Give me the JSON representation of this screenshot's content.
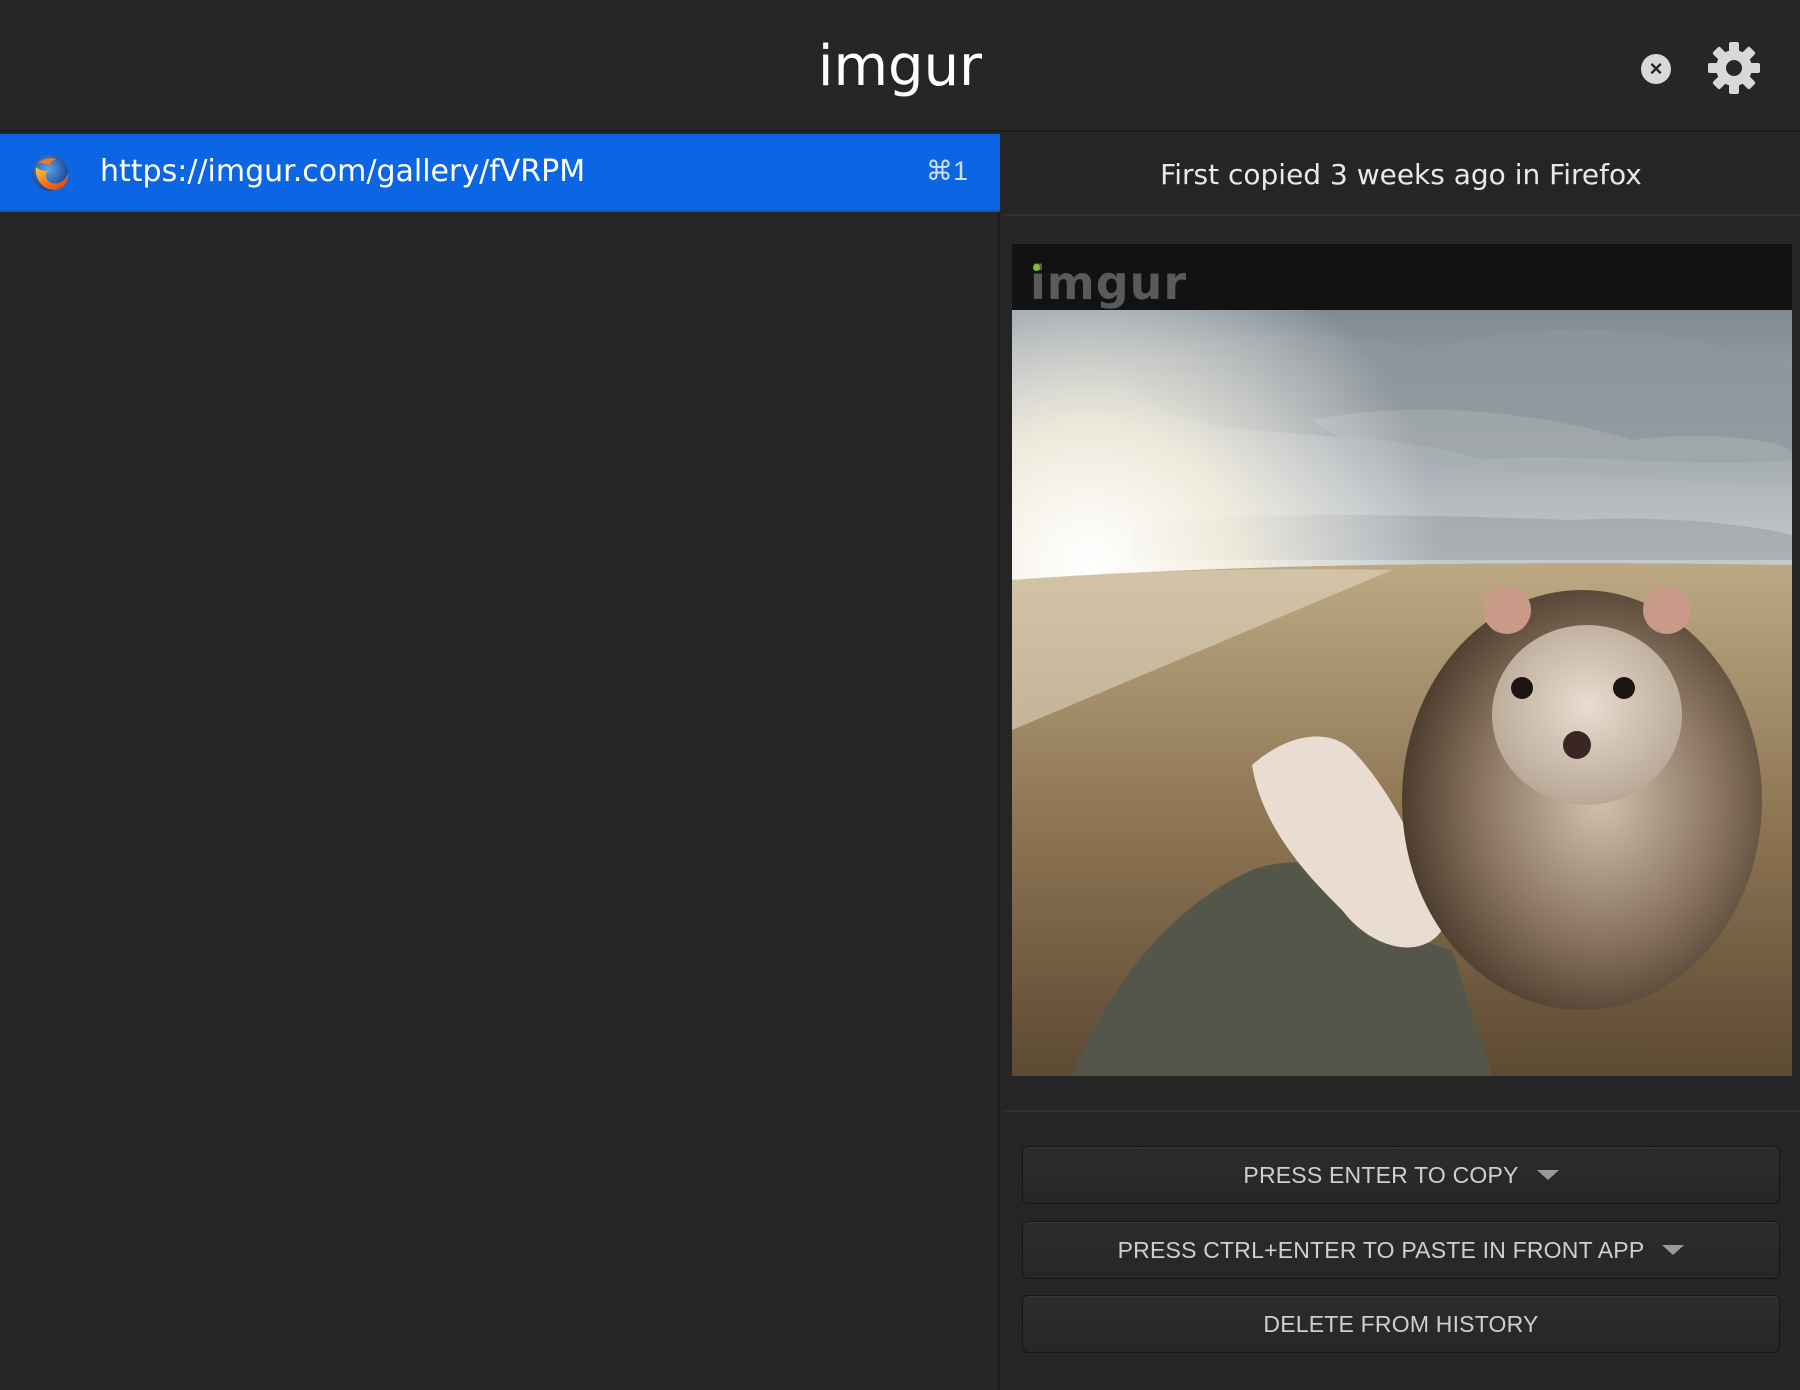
{
  "search": {
    "value": "imgur"
  },
  "header": {
    "clear_icon": "close-circle-icon",
    "settings_icon": "gear-icon"
  },
  "list": {
    "items": [
      {
        "icon": "firefox-icon",
        "text": "https://imgur.com/gallery/fVRPM",
        "shortcut": "⌘1",
        "selected": true
      }
    ]
  },
  "detail": {
    "meta": "First copied 3 weeks ago in Firefox",
    "preview": {
      "logo": "imgur",
      "subject": "hedgehog-photo"
    },
    "actions": {
      "copy_label": "PRESS ENTER TO COPY",
      "paste_label": "PRESS CTRL+ENTER TO PASTE IN FRONT APP",
      "delete_label": "DELETE FROM HISTORY"
    }
  },
  "colors": {
    "background": "#252525",
    "selection": "#0c66e4",
    "text": "#e6e6e6"
  }
}
